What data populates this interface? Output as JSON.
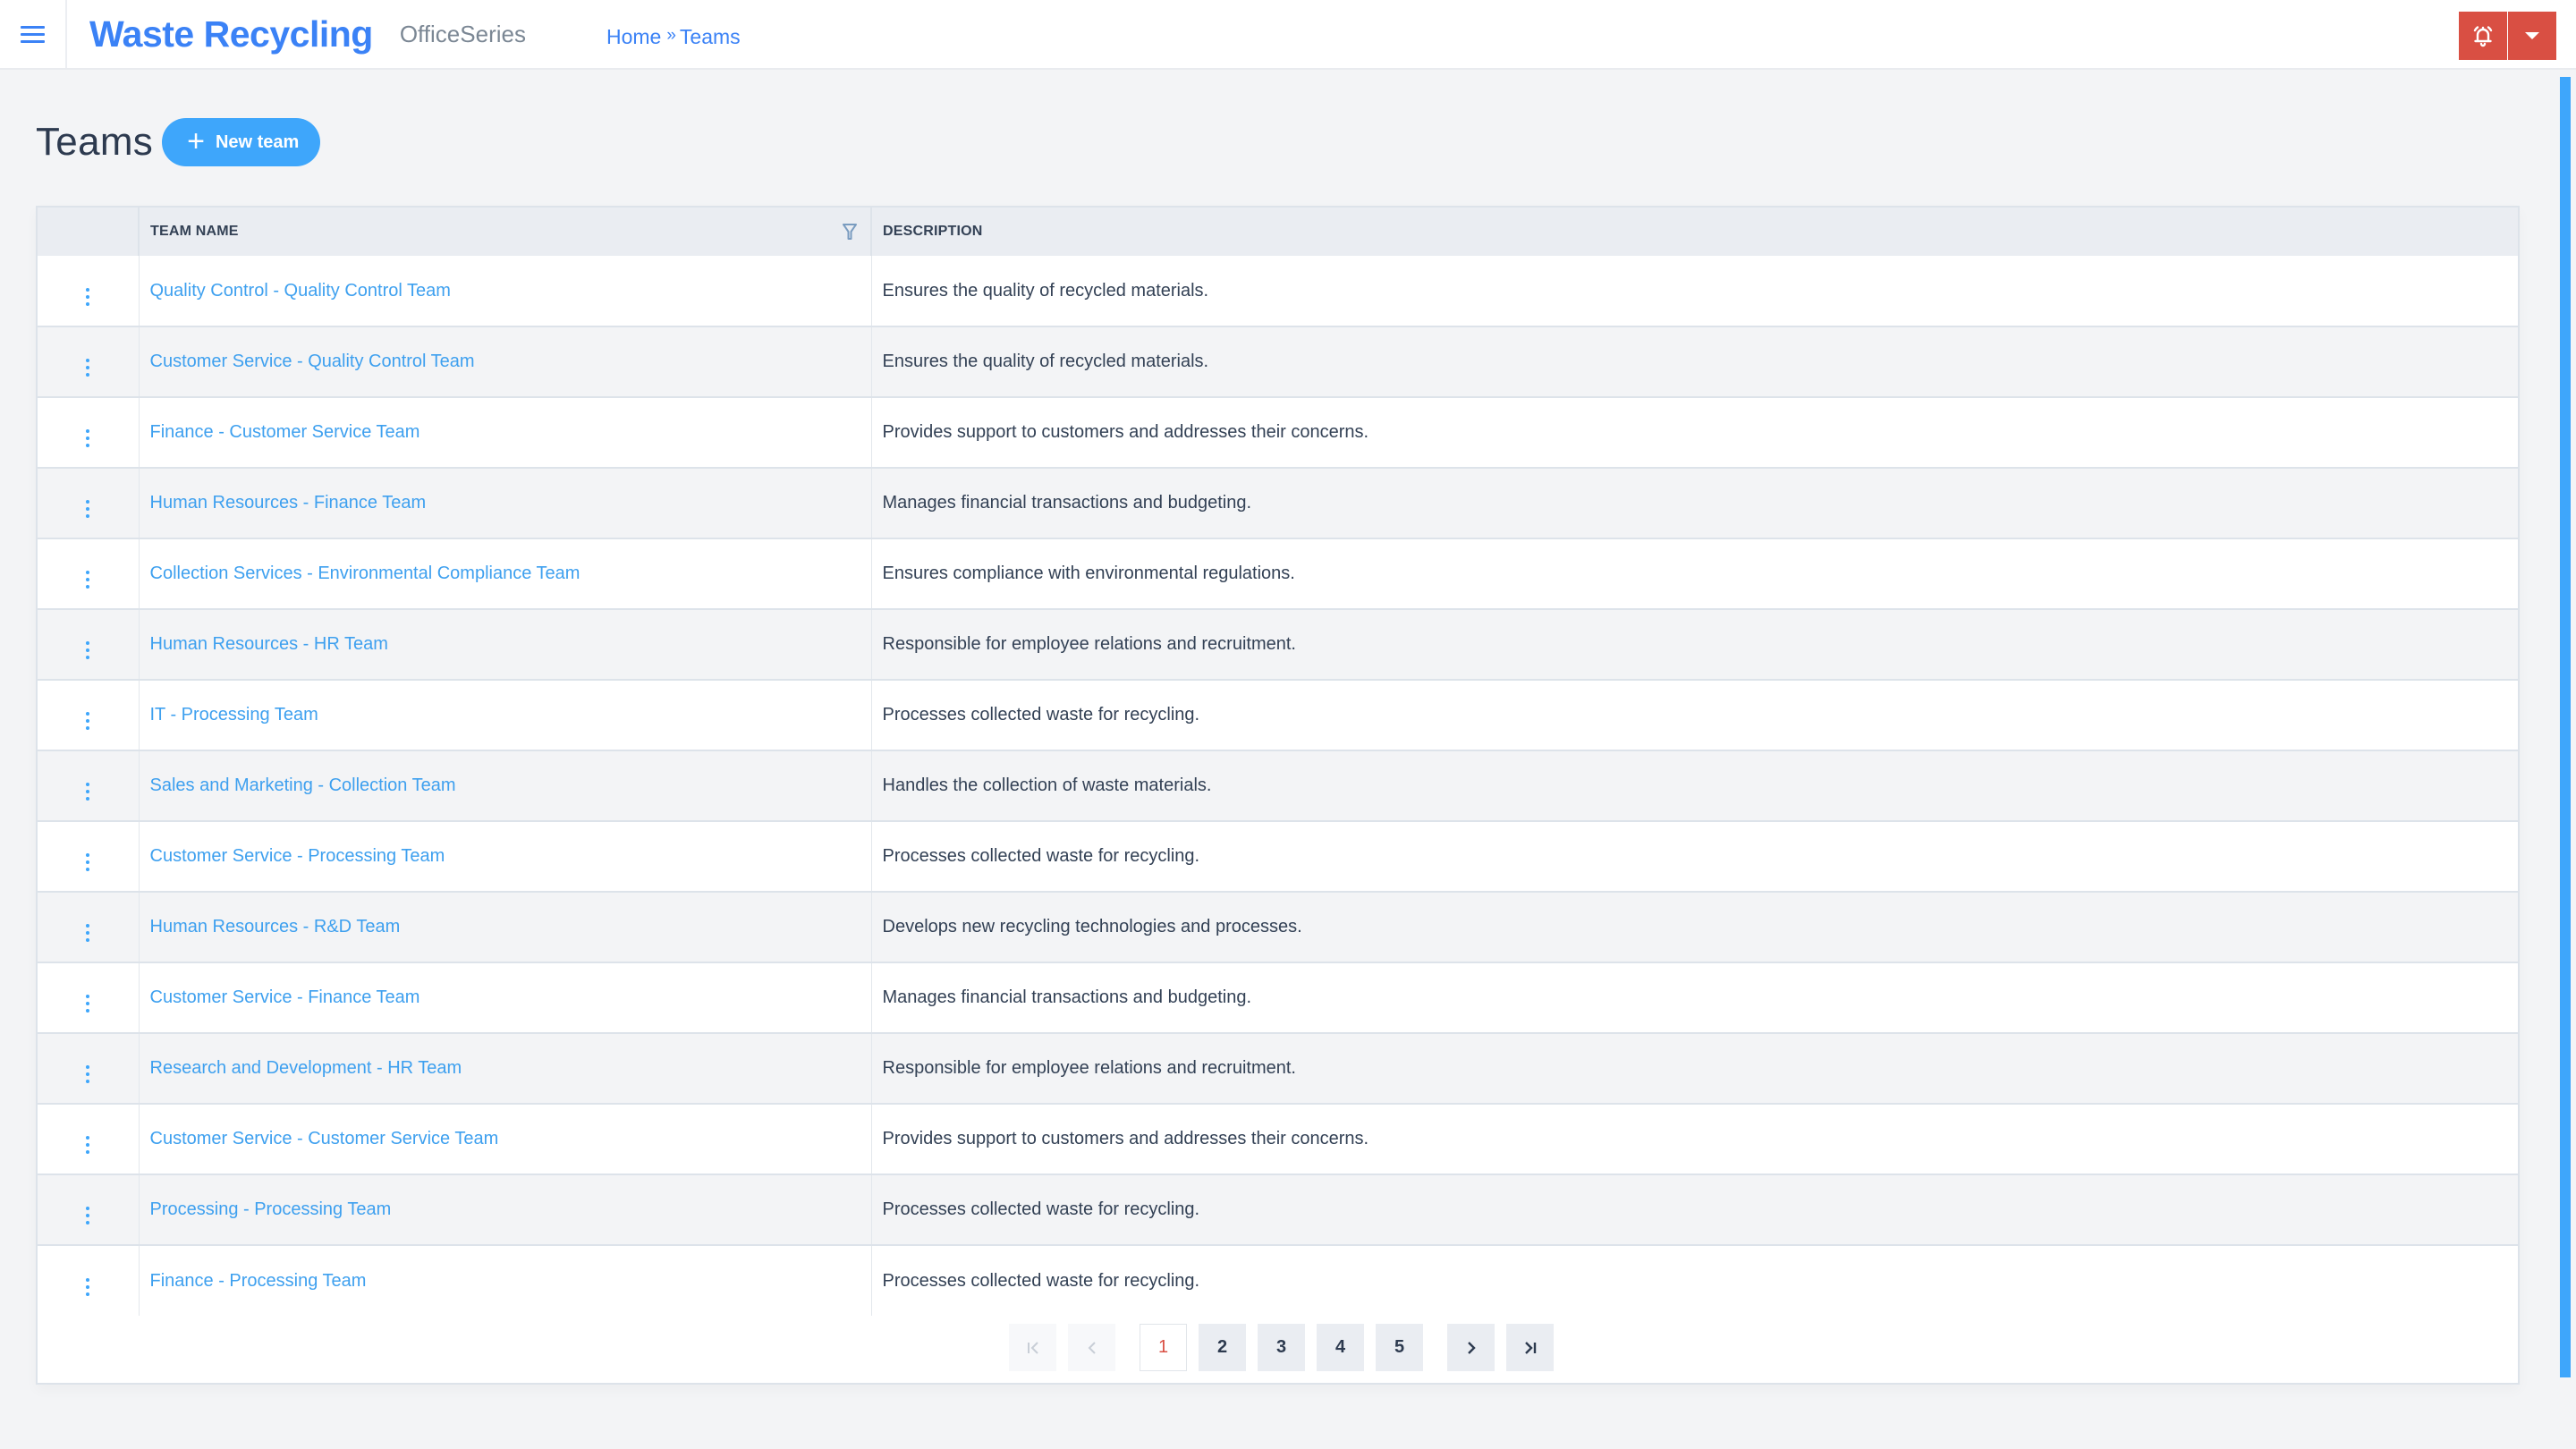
{
  "header": {
    "brand": "Waste Recycling",
    "product": "OfficeSeries",
    "breadcrumb": [
      {
        "label": "Home"
      },
      {
        "label": "Teams"
      }
    ],
    "breadcrumb_separator": "»",
    "icons": {
      "menu": "hamburger-icon",
      "alerts": "bell-ringing-icon",
      "dropdown": "caret-down-icon"
    }
  },
  "page": {
    "title": "Teams",
    "new_button": {
      "icon": "plus-icon",
      "label": "New team"
    }
  },
  "table": {
    "columns": [
      {
        "key": "menu",
        "label": ""
      },
      {
        "key": "name",
        "label": "TEAM NAME",
        "filter_icon": "filter-icon"
      },
      {
        "key": "description",
        "label": "DESCRIPTION"
      }
    ],
    "rows": [
      {
        "name": "Quality Control - Quality Control Team",
        "description": "Ensures the quality of recycled materials."
      },
      {
        "name": "Customer Service - Quality Control Team",
        "description": "Ensures the quality of recycled materials."
      },
      {
        "name": "Finance - Customer Service Team",
        "description": "Provides support to customers and addresses their concerns."
      },
      {
        "name": "Human Resources - Finance Team",
        "description": "Manages financial transactions and budgeting."
      },
      {
        "name": "Collection Services - Environmental Compliance Team",
        "description": "Ensures compliance with environmental regulations."
      },
      {
        "name": "Human Resources - HR Team",
        "description": "Responsible for employee relations and recruitment."
      },
      {
        "name": "IT - Processing Team",
        "description": "Processes collected waste for recycling."
      },
      {
        "name": "Sales and Marketing - Collection Team",
        "description": "Handles the collection of waste materials."
      },
      {
        "name": "Customer Service - Processing Team",
        "description": "Processes collected waste for recycling."
      },
      {
        "name": "Human Resources - R&D Team",
        "description": "Develops new recycling technologies and processes."
      },
      {
        "name": "Customer Service - Finance Team",
        "description": "Manages financial transactions and budgeting."
      },
      {
        "name": "Research and Development - HR Team",
        "description": "Responsible for employee relations and recruitment."
      },
      {
        "name": "Customer Service - Customer Service Team",
        "description": "Provides support to customers and addresses their concerns."
      },
      {
        "name": "Processing - Processing Team",
        "description": "Processes collected waste for recycling."
      },
      {
        "name": "Finance - Processing Team",
        "description": "Processes collected waste for recycling."
      }
    ],
    "row_menu_icon": "kebab-menu-icon"
  },
  "pagination": {
    "current_page": 1,
    "pages": [
      "1",
      "2",
      "3",
      "4",
      "5"
    ],
    "first_icon": "first-page-icon",
    "prev_icon": "chevron-left-icon",
    "next_icon": "chevron-right-icon",
    "last_icon": "last-page-icon",
    "first_disabled": true,
    "prev_disabled": true
  },
  "colors": {
    "brand_blue": "#3b82f6",
    "link_blue": "#3ea0ef",
    "accent_blue": "#3ea6fb",
    "alert_red": "#d94f43",
    "text_dark": "#334155",
    "page_bg": "#f3f4f6",
    "header_row_bg": "#eaedf2"
  }
}
